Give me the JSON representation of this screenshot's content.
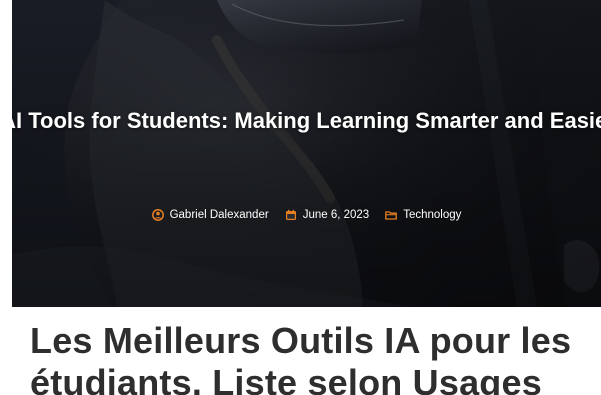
{
  "hero": {
    "title": "AI Tools for Students: Making Learning Smarter and Easier",
    "accent_color": "#e67e22",
    "meta": {
      "author_icon": "user-circle-icon",
      "author": "Gabriel Dalexander",
      "date_icon": "calendar-icon",
      "date": "June 6, 2023",
      "category_icon": "folder-icon",
      "category": "Technology"
    }
  },
  "post": {
    "title": "Les Meilleurs Outils IA pour les étudiants. Liste selon Usages"
  }
}
